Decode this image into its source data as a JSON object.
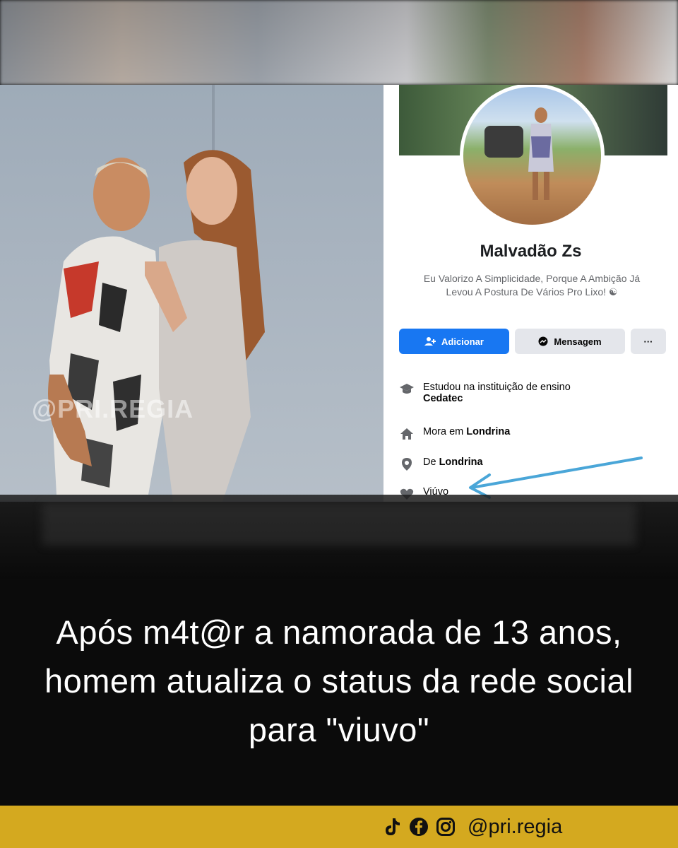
{
  "watermark": "@PRI.REGIA",
  "profile": {
    "name": "Malvadão Zs",
    "bio": "Eu Valorizo A Simplicidade, Porque A Ambição Já Levou A Postura De Vários Pro Lixo!",
    "buttons": {
      "add": "Adicionar",
      "message": "Mensagem",
      "more": "···"
    },
    "info": {
      "studied_prefix": "Estudou na instituição de ensino",
      "studied_place": "Cedatec",
      "lives_prefix": "Mora em",
      "lives_place": "Londrina",
      "from_prefix": "De",
      "from_place": "Londrina",
      "relationship": "Viúvo"
    }
  },
  "headline": "Após m4t@r a namorada de 13 anos, homem atualiza o status da rede social para \"viuvo\"",
  "footer": {
    "icons": [
      "tiktok-icon",
      "facebook-icon",
      "instagram-icon"
    ],
    "handle": "@pri.regia"
  },
  "colors": {
    "accent_footer": "#d4a91f",
    "fb_blue": "#1877f2",
    "arrow": "#4aa6d8"
  }
}
